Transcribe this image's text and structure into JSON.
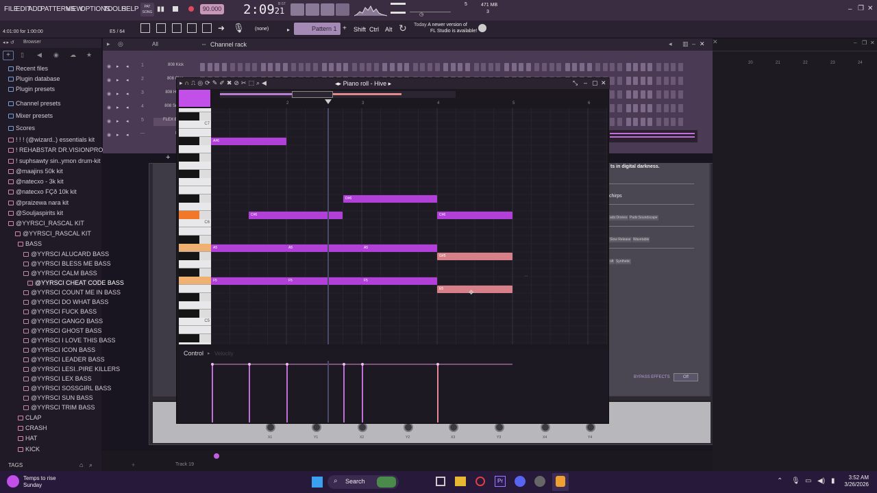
{
  "menu": {
    "items": [
      "FILE",
      "EDIT",
      "ADD",
      "PATTERNS",
      "VIEW",
      "OPTIONS",
      "TOOLS",
      "HELP"
    ]
  },
  "transport": {
    "mode_top": "PAT",
    "mode_bottom": "SONG",
    "tempo": "90.000",
    "time": "2:09",
    "time_small": "21",
    "time_label": "B:ST",
    "cpu": "5",
    "memory": "471 MB",
    "voices": "3",
    "bars_text": "4:01:00 for 1:00:00",
    "step_count": "E5 / 64"
  },
  "toolbar": {
    "snap": "(none)",
    "pattern": "Pattern 1",
    "shift": "Shift",
    "ctrl": "Ctrl",
    "alt": "Alt",
    "news_line1": "Today",
    "news_line2": "A newer version of",
    "news_line3": "FL Studio is available!"
  },
  "browser": {
    "title": "Browser",
    "items": [
      "Recent files",
      "Plugin database",
      "Plugin presets",
      "Channel presets",
      "Mixer presets",
      "Scores",
      "! ! ! (@wizard..) essentials kit",
      "! REHABSTAR DR.VISIONPROD1",
      "! suphsawty sin..ymon drum-kit",
      "@maajins 50k kit",
      "@natecxo - 3k kit",
      "@natecxo FÇð 10k kit",
      "@praizewa nara kit",
      "@Souljaspirits kit",
      "@YYRSCI_RASCAL KIT",
      "@YYRSCI_RASCAL KIT",
      "BASS",
      "@YYRSCI ALUCARD BASS",
      "@YYRSCI BLESS ME BASS",
      "@YYRSCI CALM BASS",
      "@YYRSCI CHEAT CODE BASS",
      "@YYRSCI COUNT ME IN BASS",
      "@YYRSCI DO WHAT BASS",
      "@YYRSCI FUCK BASS",
      "@YYRSCI GANGO BASS",
      "@YYRSCI GHOST BASS",
      "@YYRSCI I LOVE THIS BASS",
      "@YYRSCI ICON BASS",
      "@YYRSCI LEADER BASS",
      "@YYRSCI LESI..PIRE KILLERS",
      "@YYRSCI LEX BASS",
      "@YYRSCI SOSSGIRL BASS",
      "@YYRSCI SUN BASS",
      "@YYRSCI TRIM BASS",
      "CLAP",
      "CRASH",
      "HAT",
      "KICK"
    ],
    "tags_label": "TAGS"
  },
  "channel_rack": {
    "title": "Channel rack",
    "filter": "All",
    "channels": [
      {
        "num": "1",
        "name": "808 Kick"
      },
      {
        "num": "2",
        "name": "808 Clap"
      },
      {
        "num": "3",
        "name": "808 HiHat"
      },
      {
        "num": "4",
        "name": "808 Snare"
      },
      {
        "num": "5",
        "name": "FLEX Bass"
      },
      {
        "num": "---",
        "name": "Hive"
      }
    ]
  },
  "piano_roll": {
    "title": "Piano roll - Hive",
    "bar_numbers": [
      "2",
      "3",
      "4",
      "5",
      "6"
    ],
    "octave_labels": [
      "C7",
      "C6",
      "C5"
    ],
    "control_label": "Control",
    "velocity_label": "Velocity",
    "notes": [
      {
        "label": "A#6",
        "color": "purple"
      },
      {
        "label": "D#6",
        "color": "purple"
      },
      {
        "label": "C#6",
        "color": "purple"
      },
      {
        "label": "C#6",
        "color": "purple"
      },
      {
        "label": "A5",
        "color": "purple"
      },
      {
        "label": "A5",
        "color": "purple"
      },
      {
        "label": "A5",
        "color": "purple"
      },
      {
        "label": "G#5",
        "color": "red"
      },
      {
        "label": "F5",
        "color": "purple"
      },
      {
        "label": "F5",
        "color": "purple"
      },
      {
        "label": "F5",
        "color": "purple"
      },
      {
        "label": "E5",
        "color": "red"
      }
    ]
  },
  "plugin": {
    "description": "ts in digital darkness.",
    "section": "chirps",
    "tags_row1": [
      "ads:Drones",
      "Pads:Soundscape"
    ],
    "tags_row2": [
      "Slow Release",
      "Wavetable"
    ],
    "tags_row3": [
      "oft",
      "Synthetic"
    ],
    "bypass_label": "BYPASS EFFECTS",
    "bypass_value": "Off",
    "knobs": [
      "X1",
      "Y1",
      "X2",
      "Y2",
      "X3",
      "Y3",
      "X4",
      "Y4"
    ],
    "ruler": [
      "20",
      "21",
      "22",
      "23",
      "24"
    ]
  },
  "mixer": {
    "track": "Track 19"
  },
  "taskbar": {
    "weather_line1": "Temps to rise",
    "weather_line2": "Sunday",
    "search": "Search",
    "time": "3:52 AM",
    "date": "3/26/2026"
  },
  "colors": {
    "accent": "#b040d8",
    "note_red": "#d8808a",
    "menubar": "#3a2d42",
    "taskbar": "#26193a"
  }
}
